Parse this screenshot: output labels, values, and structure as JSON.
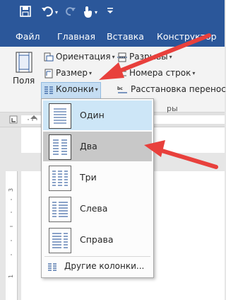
{
  "colors": {
    "brand_blue": "#2b579a",
    "arrow_red": "#e8403c",
    "dropdown_hover": "#cde6f7",
    "dropdown_selected": "#c8c8c8"
  },
  "quick_access": {
    "save_icon": "save-icon",
    "undo_icon": "undo-icon",
    "redo_icon": "redo-icon",
    "touch_icon": "touch-mode-icon",
    "customize_icon": "customize-quick-access-icon"
  },
  "tabs": [
    {
      "label": "Файл"
    },
    {
      "label": "Главная"
    },
    {
      "label": "Вставка"
    },
    {
      "label": "Конструктор"
    }
  ],
  "ribbon": {
    "margins_label": "Поля",
    "orientation_label": "Ориентация",
    "size_label": "Размер",
    "columns_label": "Колонки",
    "breaks_label": "Разрывы",
    "line_numbers_label": "Номера строк",
    "hyphenation_label": "Расстановка переносов",
    "group_label": "ры"
  },
  "columns_menu": {
    "items": [
      {
        "label": "Один",
        "columns": 1
      },
      {
        "label": "Два",
        "columns": 2
      },
      {
        "label": "Три",
        "columns": 3
      },
      {
        "label": "Слева",
        "columns": "left"
      },
      {
        "label": "Справа",
        "columns": "right"
      }
    ],
    "more_label": "Другие колонки..."
  }
}
